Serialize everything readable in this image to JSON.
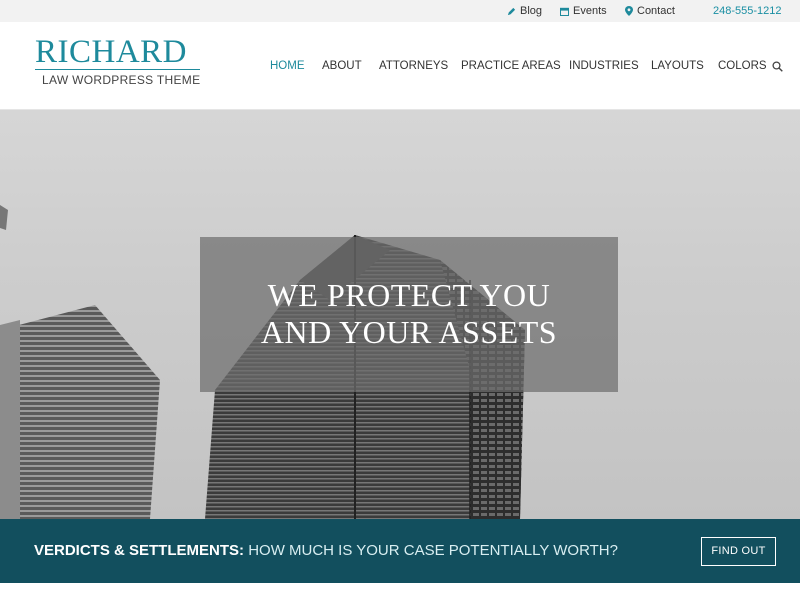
{
  "topbar": {
    "blog": "Blog",
    "events": "Events",
    "contact": "Contact",
    "phone": "248-555-1212"
  },
  "logo": {
    "title": "RICHARD",
    "subtitle": "LAW WORDPRESS THEME"
  },
  "nav": {
    "items": [
      "HOME",
      "ABOUT",
      "ATTORNEYS",
      "PRACTICE AREAS",
      "INDUSTRIES",
      "LAYOUTS",
      "COLORS"
    ],
    "active": "HOME"
  },
  "hero": {
    "line1": "WE PROTECT YOU",
    "line2": "AND YOUR ASSETS"
  },
  "banner": {
    "strong": "VERDICTS & SETTLEMENTS:",
    "rest": "HOW MUCH IS YOUR CASE POTENTIALLY WORTH?",
    "button": "FIND OUT"
  },
  "colors": {
    "accent": "#1e8a9c",
    "banner": "#124f5e"
  },
  "icons": [
    "pencil-icon",
    "calendar-icon",
    "map-pin-icon",
    "search-icon"
  ]
}
